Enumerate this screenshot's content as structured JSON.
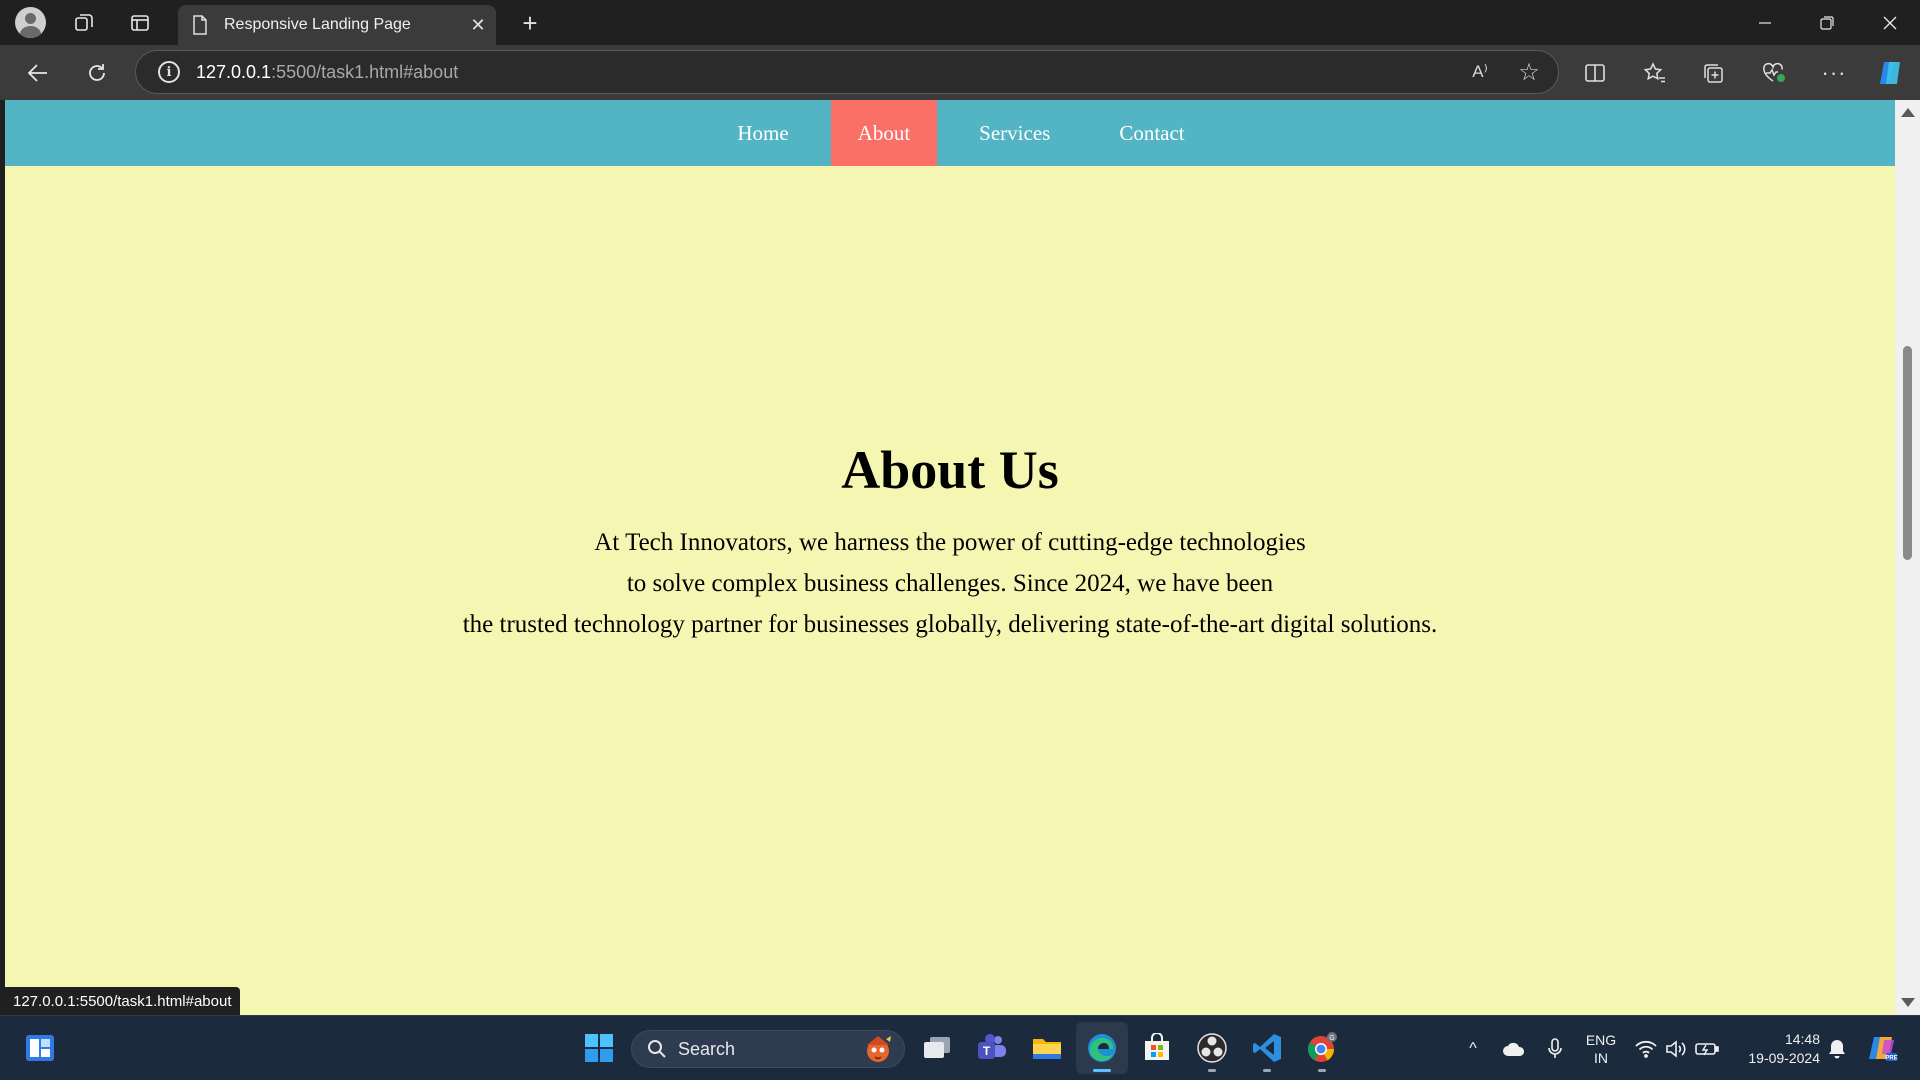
{
  "browser": {
    "tab_title": "Responsive Landing Page",
    "tab_close": "✕",
    "new_tab": "+",
    "url_host": "127.0.0.1",
    "url_rest": ":5500/task1.html#about",
    "read_aloud": "A⁾",
    "more": "···",
    "status_url": "127.0.0.1:5500/task1.html#about"
  },
  "site": {
    "nav": [
      {
        "label": "Home",
        "active": false
      },
      {
        "label": "About",
        "active": true
      },
      {
        "label": "Services",
        "active": false
      },
      {
        "label": "Contact",
        "active": false
      }
    ],
    "about": {
      "title": "About Us",
      "lines": [
        "At Tech Innovators, we harness the power of cutting-edge technologies",
        "to solve complex business challenges. Since 2024, we have been",
        "the trusted technology partner for businesses globally, delivering state-of-the-art digital solutions."
      ]
    },
    "colors": {
      "nav_bg": "#53b4c3",
      "nav_active": "#fa6f66",
      "page_bg": "#f6f6b3"
    }
  },
  "taskbar": {
    "search_label": "Search",
    "chevron": "^",
    "lang_1": "ENG",
    "lang_2": "IN",
    "time": "14:48",
    "date": "19-09-2024",
    "icons": [
      "widgets-icon",
      "start-icon",
      "search-icon",
      "task-view-icon",
      "teams-icon",
      "file-explorer-icon",
      "edge-icon",
      "store-icon",
      "obs-icon",
      "vscode-icon",
      "chrome-icon"
    ]
  }
}
